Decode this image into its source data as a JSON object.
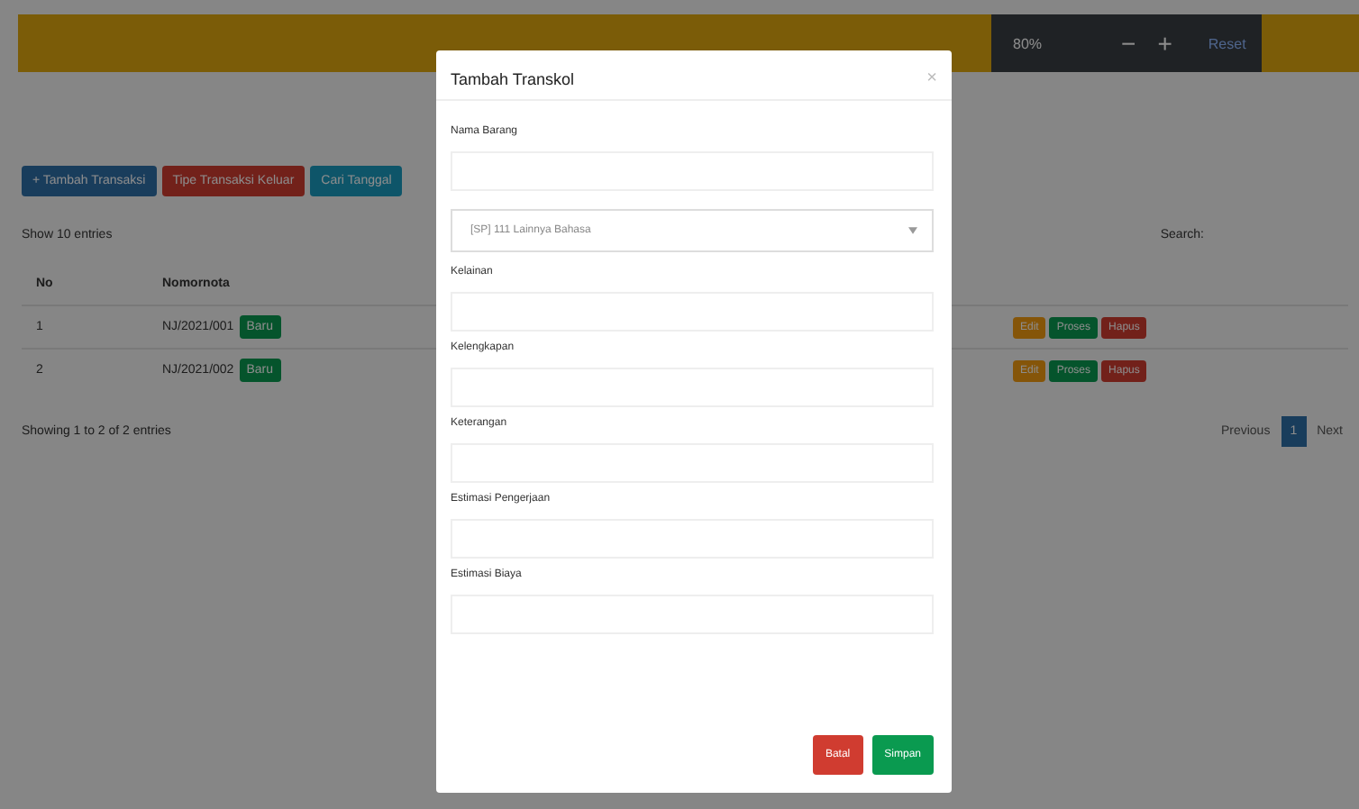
{
  "zoom_bar": {
    "percent": "80%",
    "minus": "−",
    "plus": "+",
    "reset": "Reset"
  },
  "toolbar": [
    {
      "label": "+ Tambah Transaksi",
      "kind": "primary"
    },
    {
      "label": "Tipe Transaksi Keluar",
      "kind": "danger"
    },
    {
      "label": "Cari Tanggal",
      "kind": "info"
    }
  ],
  "length_label": "Show 10 entries",
  "search_label": "Search:",
  "table": {
    "columns": [
      "No",
      "Nomornota"
    ],
    "rows": [
      {
        "no": "1",
        "nota": "NJ/2021/001",
        "tag": "Baru",
        "actions": [
          {
            "label": "Edit",
            "kind": "warning"
          },
          {
            "label": "Proses",
            "kind": "success"
          },
          {
            "label": "Hapus",
            "kind": "danger"
          }
        ]
      },
      {
        "no": "2",
        "nota": "NJ/2021/002",
        "tag": "Baru",
        "actions": [
          {
            "label": "Edit",
            "kind": "warning"
          },
          {
            "label": "Proses",
            "kind": "success"
          },
          {
            "label": "Hapus",
            "kind": "danger"
          }
        ]
      }
    ]
  },
  "info": "Showing 1 to 2 of 2 entries",
  "pagination": [
    {
      "label": "Previous",
      "selected": false
    },
    {
      "label": "1",
      "selected": true
    },
    {
      "label": "Next",
      "selected": false
    }
  ],
  "modal": {
    "title": "Tambah Transkol",
    "close": "×",
    "fields": [
      {
        "kind": "input",
        "label": "Nama Barang"
      },
      {
        "kind": "select",
        "value": "[SP] 111 Lainnya Bahasa"
      },
      {
        "kind": "input",
        "label": "Kelainan"
      },
      {
        "kind": "input",
        "label": "Kelengkapan"
      },
      {
        "kind": "input",
        "label": "Keterangan"
      },
      {
        "kind": "input",
        "label": "Estimasi Pengerjaan"
      },
      {
        "kind": "input",
        "label": "Estimasi Biaya"
      }
    ],
    "buttons": [
      {
        "label": "Batal",
        "kind": "danger"
      },
      {
        "label": "Simpan",
        "kind": "success"
      }
    ]
  }
}
